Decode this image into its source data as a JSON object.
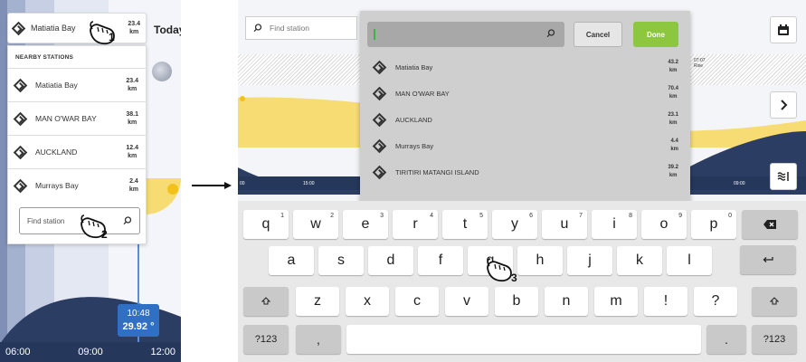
{
  "left_phone": {
    "selected_station": {
      "name": "Matiatia Bay",
      "distance": "23.4",
      "unit": "km"
    },
    "today_label": "Today",
    "panel_title": "NEARBY STATIONS",
    "stations": [
      {
        "name": "Matiatia Bay",
        "distance": "23.4",
        "unit": "km"
      },
      {
        "name": "MAN O'WAR BAY",
        "distance": "38.1",
        "unit": "km"
      },
      {
        "name": "AUCKLAND",
        "distance": "12.4",
        "unit": "km"
      },
      {
        "name": "Murrays Bay",
        "distance": "2.4",
        "unit": "km"
      }
    ],
    "find_placeholder": "Find station",
    "tooltip": {
      "time": "10:48",
      "value": "29.92 °"
    },
    "time_axis": [
      "06:00",
      "09:00",
      "12:00"
    ]
  },
  "tablet": {
    "search_placeholder": "Find station",
    "cancel_label": "Cancel",
    "done_label": "Done",
    "results": [
      {
        "name": "Matiatia Bay",
        "distance": "43.2",
        "unit": "km"
      },
      {
        "name": "MAN O'WAR BAY",
        "distance": "70.4",
        "unit": "km"
      },
      {
        "name": "AUCKLAND",
        "distance": "23.1",
        "unit": "km"
      },
      {
        "name": "Murrays Bay",
        "distance": "4.4",
        "unit": "km"
      },
      {
        "name": "TIRITIRI MATANGI ISLAND",
        "distance": "39.2",
        "unit": "km"
      }
    ],
    "rise_time": "07:07",
    "rise_label": "Rise",
    "time_axis": [
      "00",
      "15:00",
      "09:00"
    ],
    "keyboard": {
      "row1": [
        {
          "key": "q",
          "num": "1"
        },
        {
          "key": "w",
          "num": "2"
        },
        {
          "key": "e",
          "num": "3"
        },
        {
          "key": "r",
          "num": "4"
        },
        {
          "key": "t",
          "num": "5"
        },
        {
          "key": "y",
          "num": "6"
        },
        {
          "key": "u",
          "num": "7"
        },
        {
          "key": "i",
          "num": "8"
        },
        {
          "key": "o",
          "num": "9"
        },
        {
          "key": "p",
          "num": "0"
        }
      ],
      "row2": [
        "a",
        "s",
        "d",
        "f",
        "g",
        "h",
        "j",
        "k",
        "l"
      ],
      "row3": [
        "z",
        "x",
        "c",
        "v",
        "b",
        "n",
        "m",
        "!",
        "?"
      ],
      "symbols_label": "?123",
      "comma_label": ",",
      "period_label": "."
    }
  },
  "steps": [
    "1",
    "2",
    "3"
  ],
  "colors": {
    "navy": "#26375c",
    "green": "#8dc63f",
    "tooltip_blue": "#2f6fc4",
    "tide_yellow": "#f6dc72"
  }
}
